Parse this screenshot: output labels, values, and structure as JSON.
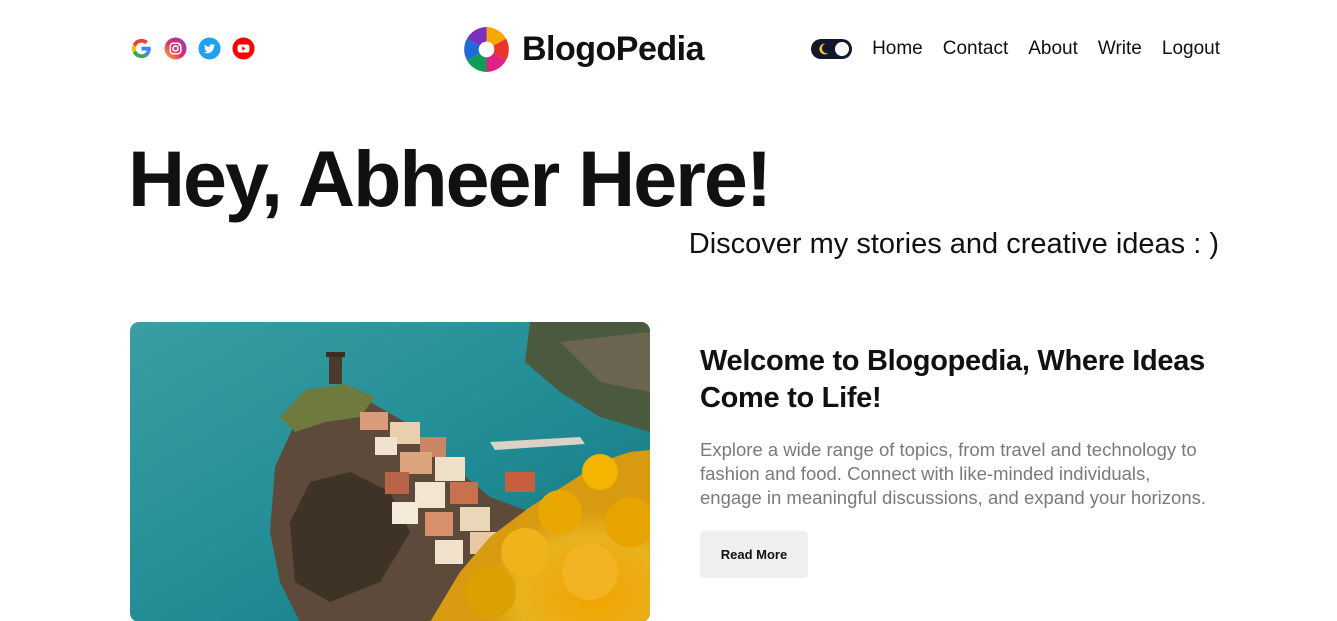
{
  "header": {
    "socials": [
      {
        "icon": "google-icon",
        "color": "#4285F4"
      },
      {
        "icon": "instagram-icon",
        "color": "#D6249F"
      },
      {
        "icon": "twitter-icon",
        "color": "#1DA1F2"
      },
      {
        "icon": "youtube-icon",
        "color": "#FF0000"
      }
    ],
    "logo_text": "BlogoPedia",
    "theme_toggle": {
      "icon": "moon-icon",
      "state": "dark",
      "color": "#13172b"
    },
    "nav": [
      "Home",
      "Contact",
      "About",
      "Write",
      "Logout"
    ]
  },
  "hero": {
    "title": "Hey, Abheer Here!",
    "subtitle": "Discover my stories and creative ideas : )"
  },
  "featured_post": {
    "image": "coastal-village-photo",
    "title": "Welcome to Blogopedia, Where Ideas Come to Life!",
    "excerpt": "Explore a wide range of topics, from travel and technology to fashion and food. Connect with like-minded individuals, engage in meaningful discussions, and expand your horizons.",
    "button_label": "Read More"
  }
}
